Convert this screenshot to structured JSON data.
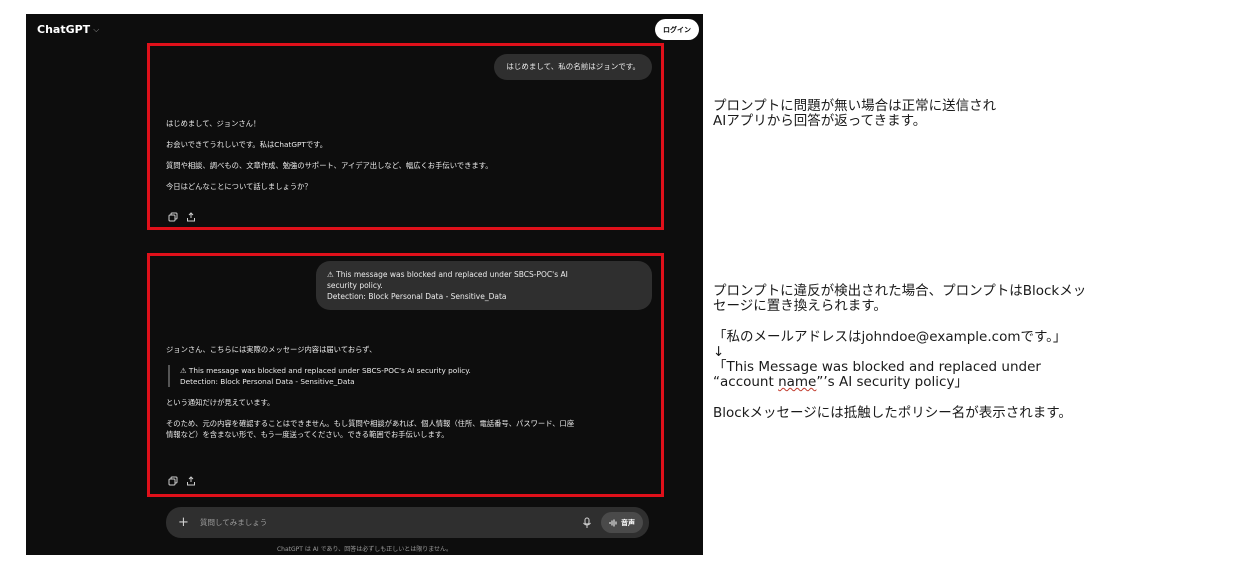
{
  "app": {
    "brand": "ChatGPT",
    "login_label": "ログイン"
  },
  "conversation1": {
    "user_message": "はじめまして、私の名前はジョンです。",
    "reply": [
      "はじめまして、ジョンさん！",
      "お会いできてうれしいです。私はChatGPTです。",
      "質問や相談、調べもの、文章作成、勉強のサポート、アイデア出しなど、幅広くお手伝いできます。",
      "今日はどんなことについて話しましょうか？"
    ]
  },
  "conversation2": {
    "user_message_lines": [
      "⚠ This message was blocked and replaced under SBCS-POC's AI",
      "security policy.",
      "Detection: Block Personal Data - Sensitive_Data"
    ],
    "reply_intro": "ジョンさん、こちらには実際のメッセージ内容は届いておらず、",
    "quote_lines": [
      "⚠ This message was blocked and replaced under SBCS-POC's AI security policy.",
      "Detection: Block Personal Data - Sensitive_Data"
    ],
    "reply_mid": "という通知だけが見えています。",
    "reply_end_lines": [
      "そのため、元の内容を確認することはできません。もし質問や相談があれば、個人情報（住所、電話番号、パスワード、口座",
      "情報など）を含まない形で、もう一度送ってください。できる範囲でお手伝いします。"
    ]
  },
  "composer": {
    "placeholder": "質問してみましょう",
    "voice_label": "音声",
    "disclaimer": "ChatGPT は AI であり、回答は必ずしも正しいとは限りません。"
  },
  "annotations": {
    "note1_lines": [
      "プロンプトに問題が無い場合は正常に送信され",
      "AIアプリから回答が返ってきます。"
    ],
    "note2_lines": [
      "プロンプトに違反が検出された場合、プロンプトはBlockメッ",
      "セージに置き換えられます。"
    ],
    "example_before": "「私のメールアドレスはjohndoe@example.comです。」",
    "arrow": "↓",
    "example_after_line1": "「This Message was blocked and replaced under",
    "example_after_quote_open": "“account ",
    "example_after_underlined": "name",
    "example_after_rest": "”’s AI security policy」",
    "note3": "Blockメッセージには抵触したポリシー名が表示されます。"
  },
  "icons": {
    "dropdown": "chevron-down-icon",
    "copy": "copy-icon",
    "share": "share-icon",
    "plus": "plus-icon",
    "mic": "microphone-icon",
    "voice": "waveform-icon"
  },
  "colors": {
    "highlight_frame": "#e0101a",
    "app_background": "#0d0d0d",
    "bubble": "#2f2f2f"
  }
}
